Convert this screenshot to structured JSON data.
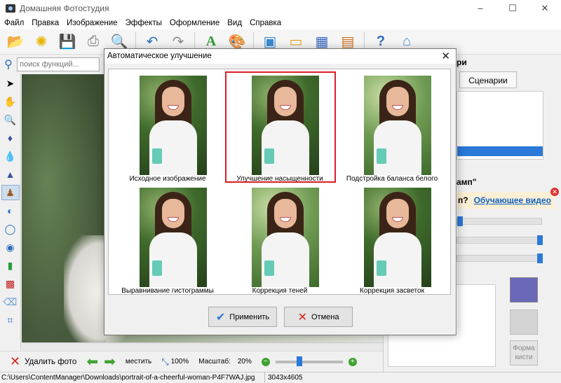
{
  "window": {
    "title": "Домашняя Фотостудия",
    "controls": [
      "–",
      "☐",
      "✕"
    ]
  },
  "menu": [
    "Файл",
    "Правка",
    "Изображение",
    "Эффекты",
    "Оформление",
    "Вид",
    "Справка"
  ],
  "toolbar": {
    "icons": [
      "open-icon",
      "effects-icon",
      "save-icon",
      "print-icon",
      "preview-icon",
      "undo-icon",
      "redo-icon",
      "text-icon",
      "palette-icon",
      "frame-icon",
      "postcard-icon",
      "calendar-icon",
      "collage-icon",
      "help-icon",
      "home-icon"
    ]
  },
  "search": {
    "placeholder": "поиск функций..."
  },
  "right_panel": {
    "title_partial": "ри",
    "tab": "Сценарии",
    "title2_partial": "амп\"",
    "help_q": "п?",
    "help_link": "Обучающее видео",
    "shape_button": "Форма кисти"
  },
  "dialog": {
    "title": "Автоматическое улучшение",
    "close": "✕",
    "variants": [
      {
        "label": "Исходное изображение",
        "selected": false
      },
      {
        "label": "Улучшение насыщенности",
        "selected": true
      },
      {
        "label": "Подстройка баланса белого",
        "selected": false
      },
      {
        "label": "Выравнивание гистограммы",
        "selected": false
      },
      {
        "label": "Коррекция теней",
        "selected": false
      },
      {
        "label": "Коррекция засветок",
        "selected": false
      }
    ],
    "apply": "Применить",
    "cancel": "Отмена"
  },
  "bottom": {
    "delete": "Удалить фото",
    "fit": "местить",
    "zoom_pct": "100%",
    "scale_label": "Масштаб:",
    "scale_value": "20%"
  },
  "status": {
    "path": "C:\\Users\\ContentManager\\Downloads\\portrait-of-a-cheerful-woman-P4F7WAJ.jpg",
    "dims": "3043x4605"
  }
}
